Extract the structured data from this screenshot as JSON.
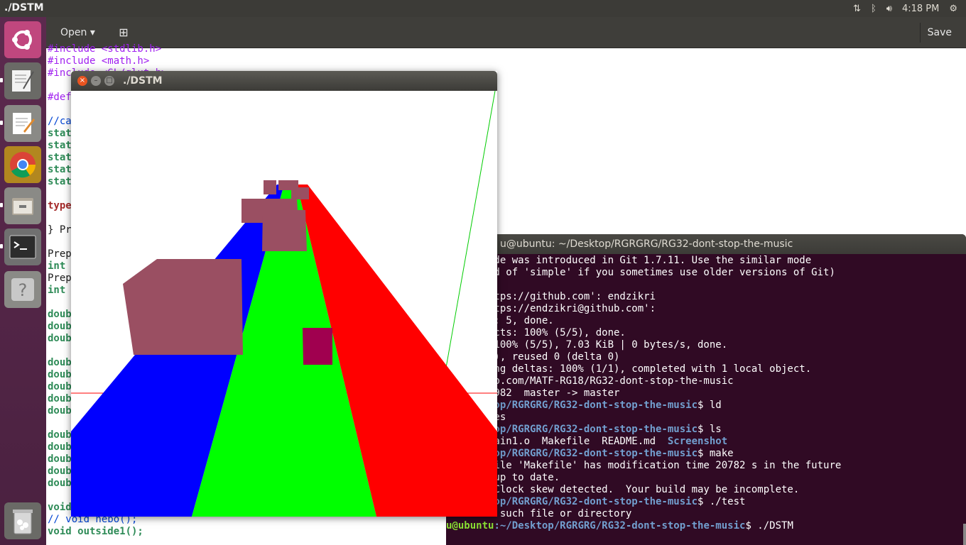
{
  "top_panel": {
    "app_title": "./DSTM",
    "clock": "4:18 PM"
  },
  "launcher": {
    "items": [
      "ubuntu-dash",
      "text-editor-notes",
      "gedit",
      "chrome",
      "files",
      "terminal",
      "help",
      "trash"
    ]
  },
  "gedit": {
    "open_label": "Open",
    "save_label": "Save",
    "lines": [
      {
        "text": "#include <stdlib.h>",
        "cls": "pp"
      },
      {
        "text": "#include <math.h>",
        "cls": "pp"
      },
      {
        "text": "#include <GL/glut.h>",
        "cls": "pp"
      },
      {
        "text": "",
        "cls": "tx"
      },
      {
        "text": "#def",
        "cls": "pp"
      },
      {
        "text": "",
        "cls": "tx"
      },
      {
        "text": "//ca",
        "cls": "cm"
      },
      {
        "text": "stat",
        "cls": "kw"
      },
      {
        "text": "stat",
        "cls": "kw"
      },
      {
        "text": "stat",
        "cls": "kw"
      },
      {
        "text": "stat",
        "cls": "kw"
      },
      {
        "text": "stat",
        "cls": "kw"
      },
      {
        "text": "",
        "cls": "tx"
      },
      {
        "text": "type",
        "cls": "ty"
      },
      {
        "text": "",
        "cls": "tx"
      },
      {
        "text": "} Pr",
        "cls": "tx"
      },
      {
        "text": "",
        "cls": "tx"
      },
      {
        "text": "Prep",
        "cls": "tx"
      },
      {
        "text": "int ",
        "cls": "kw"
      },
      {
        "text": "Prep",
        "cls": "tx"
      },
      {
        "text": "int ",
        "cls": "kw"
      },
      {
        "text": "",
        "cls": "tx"
      },
      {
        "text": "doub",
        "cls": "kw"
      },
      {
        "text": "doub",
        "cls": "kw"
      },
      {
        "text": "doub",
        "cls": "kw"
      },
      {
        "text": "",
        "cls": "tx"
      },
      {
        "text": "doub",
        "cls": "kw"
      },
      {
        "text": "doub",
        "cls": "kw"
      },
      {
        "text": "doub",
        "cls": "kw"
      },
      {
        "text": "doub",
        "cls": "kw"
      },
      {
        "text": "doub",
        "cls": "kw"
      },
      {
        "text": "",
        "cls": "tx"
      },
      {
        "text": "doub",
        "cls": "kw"
      },
      {
        "text": "doub",
        "cls": "kw"
      },
      {
        "text": "doub",
        "cls": "kw"
      },
      {
        "text": "doub",
        "cls": "kw"
      },
      {
        "text": "doub",
        "cls": "kw"
      },
      {
        "text": "",
        "cls": "tx"
      },
      {
        "text": "void",
        "cls": "kw"
      },
      {
        "text": "// void nebo();",
        "cls": "cm"
      },
      {
        "text": "void outside1();",
        "cls": "kw"
      }
    ]
  },
  "terminal": {
    "title": "u@ubuntu: ~/Desktop/RGRGRG/RG32-dont-stop-the-music",
    "lines": [
      [
        {
          "t": "mple' mode was introduced in Git 1.7.11. Use the similar mode",
          "c": ""
        }
      ],
      [
        {
          "t": "' instead of 'simple' if you sometimes use older versions of Git)",
          "c": ""
        }
      ],
      [
        {
          "t": "",
          "c": ""
        }
      ],
      [
        {
          "t": " for 'https://github.com': endzikri",
          "c": ""
        }
      ],
      [
        {
          "t": " for 'https://endzikri@github.com':",
          "c": ""
        }
      ],
      [
        {
          "t": " objects: 5, done.",
          "c": ""
        }
      ],
      [
        {
          "t": "ing objects: 100% (5/5), done.",
          "c": ""
        }
      ],
      [
        {
          "t": "bjects: 100% (5/5), 7.03 KiB | 0 bytes/s, done.",
          "c": ""
        }
      ],
      [
        {
          "t": "(delta 1), reused 0 (delta 0)",
          "c": ""
        }
      ],
      [
        {
          "t": " Resolving deltas: 100% (1/1), completed with 1 local object.",
          "c": ""
        }
      ],
      [
        {
          "t": "://github.com/MATF-RG18/RG32-dont-stop-the-music",
          "c": ""
        }
      ],
      [
        {
          "t": "a7..13bb982  master -> master",
          "c": ""
        }
      ],
      [
        {
          "t": ":~/Desktop/RGRGRG/RG32-dont-stop-the-music",
          "c": "pa"
        },
        {
          "t": "$ ld",
          "c": ""
        }
      ],
      [
        {
          "t": "nput files",
          "c": ""
        }
      ],
      [
        {
          "t": ":~/Desktop/RGRGRG/RG32-dont-stop-the-music",
          "c": "pa"
        },
        {
          "t": "$ ls",
          "c": ""
        }
      ],
      [
        {
          "t": "in1.c  main1.o  Makefile  README.md  ",
          "c": ""
        },
        {
          "t": "Screenshot",
          "c": "lnk"
        }
      ],
      [
        {
          "t": ":~/Desktop/RGRGRG/RG32-dont-stop-the-music",
          "c": "pa"
        },
        {
          "t": "$ make",
          "c": ""
        }
      ],
      [
        {
          "t": "rning: File 'Makefile' has modification time 20782 s in the future",
          "c": ""
        }
      ],
      [
        {
          "t": "STM' is up to date.",
          "c": ""
        }
      ],
      [
        {
          "t": "rning:  Clock skew detected.  Your build may be incomplete.",
          "c": ""
        }
      ],
      [
        {
          "t": ":~/Desktop/RGRGRG/RG32-dont-stop-the-music",
          "c": "pa"
        },
        {
          "t": "$ ./test",
          "c": ""
        }
      ],
      [
        {
          "t": "test: No such file or directory",
          "c": ""
        }
      ],
      [
        {
          "t": "u@ubuntu",
          "c": "up"
        },
        {
          "t": ":~/Desktop/RGRGRG/RG32-dont-stop-the-music",
          "c": "pa"
        },
        {
          "t": "$ ./DSTM",
          "c": ""
        }
      ]
    ]
  },
  "dstm_window": {
    "title": "./DSTM"
  },
  "colors": {
    "road_left": "#0000ff",
    "road_middle": "#00ff00",
    "road_right": "#ff0000",
    "obstacle": "#9a4f62",
    "obstacle_small": "#a0004f",
    "terminal_bg": "#300a24"
  }
}
